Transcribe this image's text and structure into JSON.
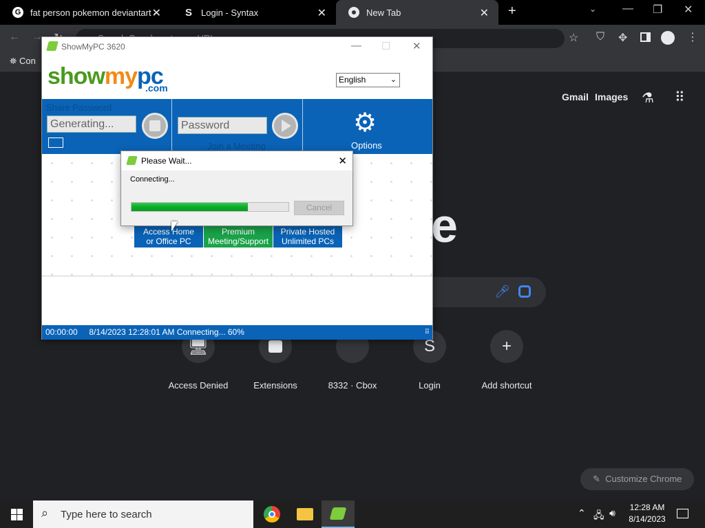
{
  "tabs": [
    {
      "title": "fat person pokemon deviantart -",
      "favicon": "google-icon"
    },
    {
      "title": "Login - Syntax",
      "favicon": "syntax-s-icon"
    },
    {
      "title": "New Tab",
      "favicon": "chrome-icon"
    }
  ],
  "omnibox": {
    "placeholder": "Search Google or type a URL"
  },
  "bookmarks": {
    "first_label": "Con"
  },
  "ntp": {
    "gmail": "Gmail",
    "images": "Images",
    "shortcuts": [
      {
        "label": "Access Denied"
      },
      {
        "label": "Extensions"
      },
      {
        "label": "8332 · Cbox"
      },
      {
        "label": "Login",
        "letter": "S"
      },
      {
        "label": "Add shortcut",
        "glyph": "+"
      }
    ],
    "customize": "Customize Chrome"
  },
  "showmypc": {
    "window_title": "ShowMyPC 3620",
    "logo_show": "show",
    "logo_my": "my",
    "logo_pc": "pc",
    "logo_com": ".com",
    "language": "English",
    "share_password_label": "Share Password",
    "share_password_value": "Generating...",
    "password_placeholder": "Password",
    "join_meeting_label": "Join a Meeting",
    "options_label": "Options",
    "promo_buttons": [
      {
        "line1": "Access Home",
        "line2": "or Office PC"
      },
      {
        "line1": "Premium",
        "line2": "Meeting/Support"
      },
      {
        "line1": "Private Hosted",
        "line2": "Unlimited PCs"
      }
    ],
    "status_text": "00:00:00     8/14/2023 12:28:01 AM Connecting... 60%"
  },
  "dialog": {
    "title": "Please Wait...",
    "message": "Connecting...",
    "progress": 0.74,
    "cancel_label": "Cancel"
  },
  "taskbar": {
    "search_placeholder": "Type here to search",
    "time": "12:28 AM",
    "date": "8/14/2023"
  },
  "colors": {
    "showmypc_blue": "#0a63b7",
    "progress_green": "#06b025",
    "premium_green": "#1aa34a"
  }
}
